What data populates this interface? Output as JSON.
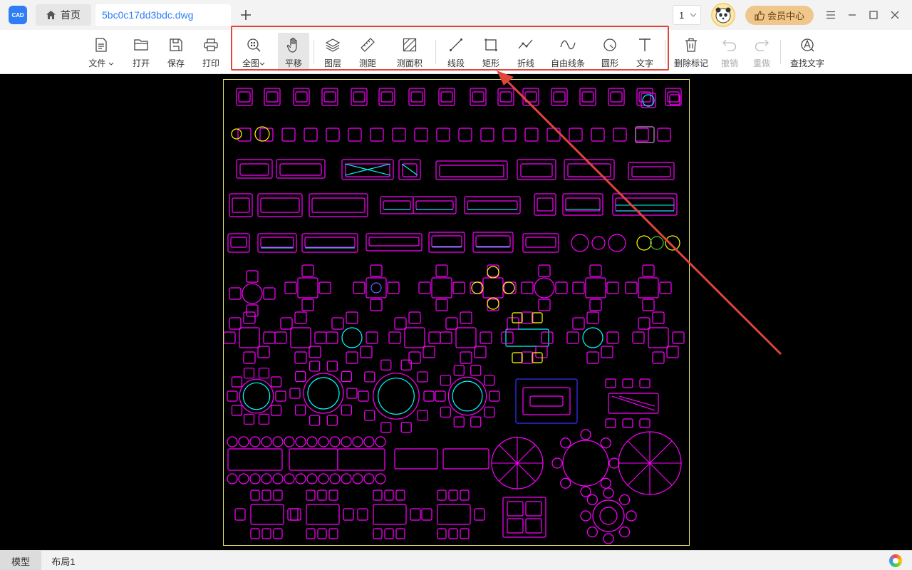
{
  "app": {
    "logo_text": "CAD",
    "accent": "#2f7ef6"
  },
  "tabs": {
    "home_label": "首页",
    "file_label": "5bc0c17dd3bdc.dwg"
  },
  "page_select": {
    "value": "1"
  },
  "vip": {
    "label": "会员中心"
  },
  "toolbar": {
    "file": "文件",
    "open": "打开",
    "save": "保存",
    "print": "打印",
    "fit": "全图",
    "pan": "平移",
    "layers": "图层",
    "measure_distance": "测距",
    "measure_area": "测面积",
    "line": "线段",
    "rectangle": "矩形",
    "polyline": "折线",
    "freehand": "自由线条",
    "circle": "圆形",
    "text": "文字",
    "delete_marks": "删除标记",
    "undo": "撤销",
    "redo": "重做",
    "find_text": "查找文字"
  },
  "annotation": {
    "highlight_color": "#e0453a"
  },
  "drawing": {
    "line_color": "#ff00ff",
    "accent_cyan": "#00ffff",
    "accent_yellow": "#ffff00",
    "frame_color": "#e8e86a"
  },
  "bottom": {
    "model_tab": "模型",
    "layout_tab": "布局1"
  }
}
